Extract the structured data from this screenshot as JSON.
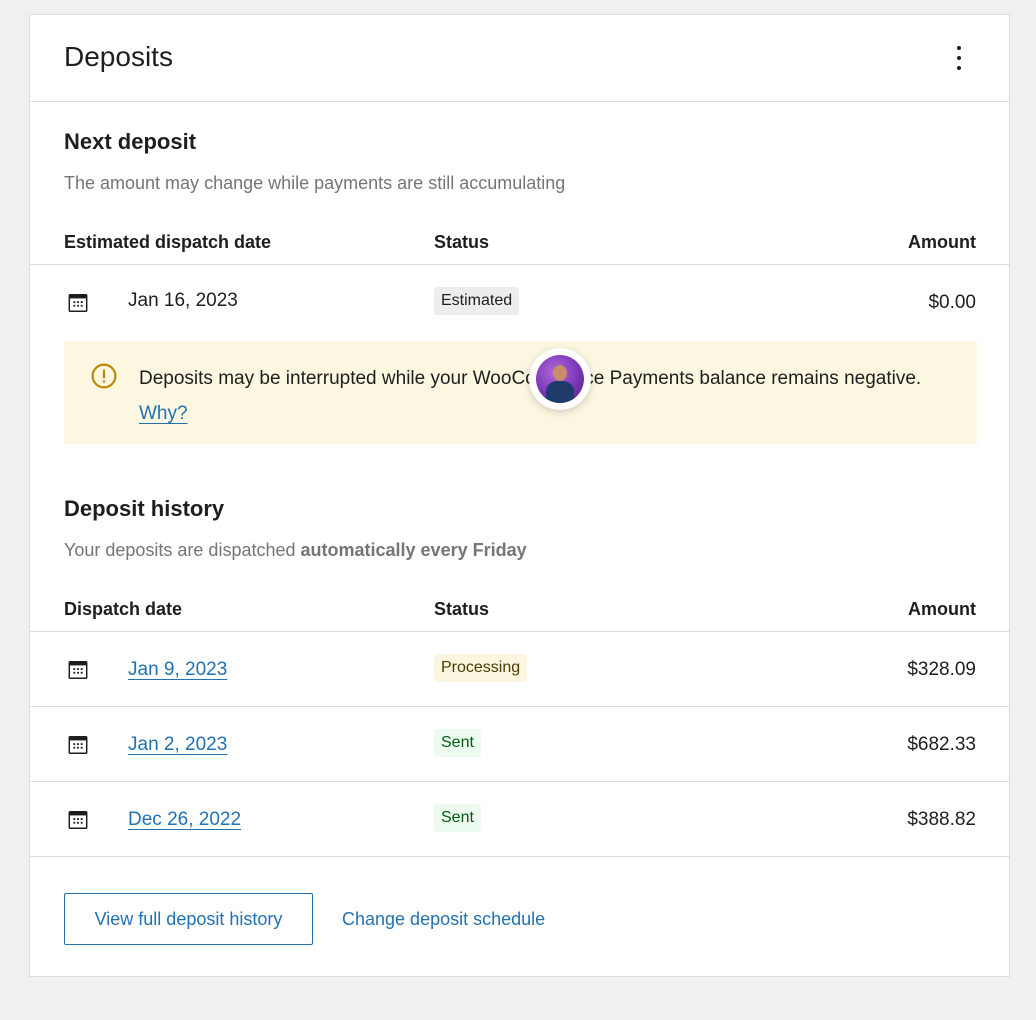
{
  "card": {
    "title": "Deposits",
    "menu_icon": "more-vertical-icon"
  },
  "next_deposit": {
    "title": "Next deposit",
    "subtitle": "The amount may change while payments are still accumulating",
    "columns": {
      "date": "Estimated dispatch date",
      "status": "Status",
      "amount": "Amount"
    },
    "row": {
      "date": "Jan 16, 2023",
      "status": "Estimated",
      "amount": "$0.00"
    }
  },
  "notice": {
    "icon": "warning-icon",
    "text": "Deposits may be interrupted while your WooCommerce Payments balance remains negative.",
    "link": "Why?",
    "colors": {
      "background": "#fcf7e1",
      "icon": "#bd8600"
    }
  },
  "deposit_history": {
    "title": "Deposit history",
    "subtitle_prefix": "Your deposits are dispatched ",
    "subtitle_bold": "automatically every Friday",
    "columns": {
      "date": "Dispatch date",
      "status": "Status",
      "amount": "Amount"
    },
    "rows": [
      {
        "date": "Jan 9, 2023",
        "status": "Processing",
        "amount": "$328.09"
      },
      {
        "date": "Jan 2, 2023",
        "status": "Sent",
        "amount": "$682.33"
      },
      {
        "date": "Dec 26, 2022",
        "status": "Sent",
        "amount": "$388.82"
      }
    ]
  },
  "footer": {
    "view_history": "View full deposit history",
    "change_schedule": "Change deposit schedule"
  },
  "colors": {
    "accent": "#2271b1",
    "processing_bg": "#fcf6e0",
    "sent_bg": "#edfaef",
    "estimated_bg": "#ededed"
  }
}
